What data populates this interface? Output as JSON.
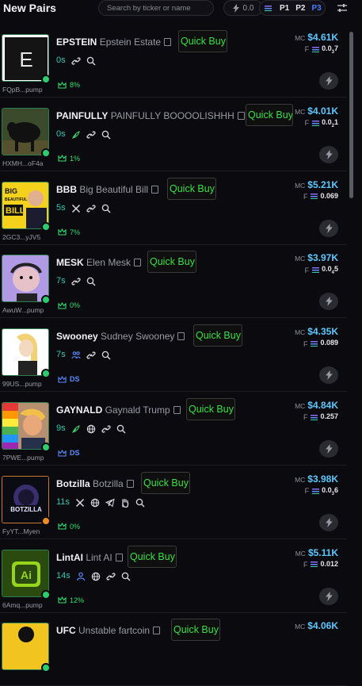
{
  "header": {
    "title": "New Pairs",
    "search_placeholder": "Search by ticker or name",
    "bolt_value": "0.0",
    "presets": [
      "P1",
      "P2",
      "P3"
    ],
    "selected_preset": "P3"
  },
  "quick_buy_label": "Quick Buy",
  "pairs": [
    {
      "ticker": "EPSTEIN",
      "name": "Epstein Estate",
      "addr": "FQpB...pump",
      "age": "0s",
      "mc": "$4.61K",
      "fee_main": "0.0",
      "fee_sub": "3",
      "fee_tail": "7",
      "stat": "8%",
      "stat_type": "pct",
      "socials": [
        "link-icon",
        "search-icon"
      ]
    },
    {
      "ticker": "PAINFULLY",
      "name": "PAINFULLY BOOOOLISHHH",
      "addr": "HXMH...oF4a",
      "age": "0s",
      "mc": "$4.01K",
      "fee_main": "0.0",
      "fee_sub": "2",
      "fee_tail": "1",
      "stat": "1%",
      "stat_type": "pct",
      "socials": [
        "feather-icon",
        "link-icon",
        "search-icon"
      ]
    },
    {
      "ticker": "BBB",
      "name": "Big Beautiful Bill",
      "addr": "2GC3...yJV5",
      "age": "5s",
      "mc": "$5.21K",
      "fee_main": "0.069",
      "fee_sub": "",
      "fee_tail": "",
      "stat": "7%",
      "stat_type": "pct",
      "socials": [
        "x-icon",
        "link-icon",
        "search-icon"
      ]
    },
    {
      "ticker": "MESK",
      "name": "Elen Mesk",
      "addr": "AwuW...pump",
      "age": "7s",
      "mc": "$3.97K",
      "fee_main": "0.0",
      "fee_sub": "4",
      "fee_tail": "5",
      "stat": "0%",
      "stat_type": "pct",
      "socials": [
        "link-icon",
        "search-icon"
      ]
    },
    {
      "ticker": "Swooney",
      "name": "Sudney Swooney",
      "addr": "99US...pump",
      "age": "7s",
      "mc": "$4.35K",
      "fee_main": "0.089",
      "fee_sub": "",
      "fee_tail": "",
      "stat": "DS",
      "stat_type": "ds",
      "socials": [
        "community-icon",
        "link-icon",
        "search-icon"
      ]
    },
    {
      "ticker": "GAYNALD",
      "name": "Gaynald Trump",
      "addr": "7PWE...pump",
      "age": "9s",
      "mc": "$4.84K",
      "fee_main": "0.257",
      "fee_sub": "",
      "fee_tail": "",
      "stat": "DS",
      "stat_type": "ds",
      "socials": [
        "feather-icon",
        "globe-icon",
        "link-icon",
        "search-icon"
      ]
    },
    {
      "ticker": "Botzilla",
      "name": "Botzilla",
      "addr": "FyYT...Myen",
      "age": "11s",
      "mc": "$3.98K",
      "fee_main": "0.0",
      "fee_sub": "3",
      "fee_tail": "6",
      "stat": "0%",
      "stat_type": "pct",
      "socials": [
        "x-icon",
        "globe-icon",
        "telegram-icon",
        "hand-icon",
        "search-icon"
      ]
    },
    {
      "ticker": "LintAI",
      "name": "Lint AI",
      "addr": "6Amq...pump",
      "age": "14s",
      "mc": "$5.11K",
      "fee_main": "0.012",
      "fee_sub": "",
      "fee_tail": "",
      "stat": "12%",
      "stat_type": "pct",
      "socials": [
        "person-icon",
        "globe-icon",
        "link-icon",
        "search-icon"
      ]
    },
    {
      "ticker": "UFC",
      "name": "Unstable fartcoin",
      "addr": "",
      "age": "",
      "mc": "$4.06K",
      "fee_main": "",
      "fee_sub": "",
      "fee_tail": "",
      "stat": "",
      "stat_type": "pct",
      "socials": []
    }
  ]
}
